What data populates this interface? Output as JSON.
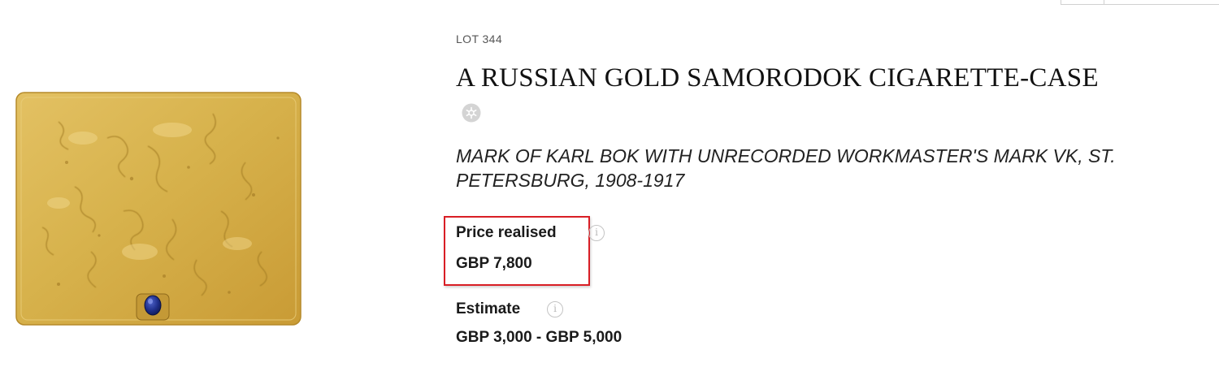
{
  "lot": {
    "number": "LOT 344",
    "title": "A RUSSIAN GOLD SAMORODOK CIGARETTE-CASE",
    "subtitle": "MARK OF KARL BOK WITH UNRECORDED WORKMASTER'S MARK VK, ST. PETERSBURG, 1908-1917"
  },
  "price": {
    "label": "Price realised",
    "value": "GBP 7,800",
    "highlight_color": "#d91e25"
  },
  "estimate": {
    "label": "Estimate",
    "value": "GBP 3,000 - GBP 5,000"
  },
  "icons": {
    "favorite": "asterisk-circle-icon",
    "info": "info-icon",
    "info_glyph": "i"
  },
  "colors": {
    "gold": "#d6b04a",
    "sapphire": "#1f2f8a"
  }
}
